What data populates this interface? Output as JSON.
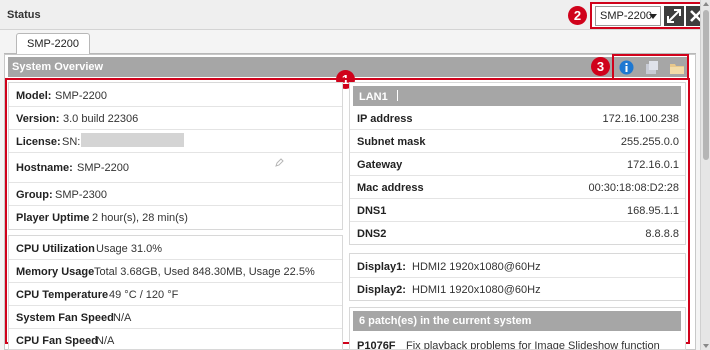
{
  "window": {
    "title": "Status",
    "device_select": "SMP-2200",
    "callouts": {
      "one": "1",
      "two": "2",
      "three": "3"
    }
  },
  "tabs": [
    "SMP-2200"
  ],
  "panel": {
    "title": "System Overview"
  },
  "device": {
    "model_label": "Model:",
    "model_value": "SMP-2200",
    "version_label": "Version:",
    "version_value": "3.0 build 22306",
    "license_label": "License:",
    "license_sn": "SN:",
    "hostname_label": "Hostname:",
    "hostname_value": "SMP-2200",
    "group_label": "Group:",
    "group_value": "SMP-2300",
    "uptime_label": "Player Uptime",
    "uptime_value": "2 hour(s), 28 min(s)"
  },
  "resources": {
    "cpu_label": "CPU Utilization",
    "cpu_value": "Usage 31.0%",
    "mem_label": "Memory Usage",
    "mem_value": "Total 3.68GB, Used 848.30MB, Usage 22.5%",
    "temp_label": "CPU Temperature",
    "temp_value": "49 °C / 120 °F",
    "fan_label": "System Fan Speed",
    "fan_value": "N/A",
    "cpufan_label": "CPU Fan Speed",
    "cpufan_value": "N/A"
  },
  "network": {
    "tab": "LAN1",
    "ip_label": "IP address",
    "ip_value": "172.16.100.238",
    "mask_label": "Subnet mask",
    "mask_value": "255.255.0.0",
    "gw_label": "Gateway",
    "gw_value": "172.16.0.1",
    "mac_label": "Mac address",
    "mac_value": "00:30:18:08:D2:28",
    "dns1_label": "DNS1",
    "dns1_value": "168.95.1.1",
    "dns2_label": "DNS2",
    "dns2_value": "8.8.8.8"
  },
  "displays": {
    "d1_label": "Display1:",
    "d1_value": "HDMI2 1920x1080@60Hz",
    "d2_label": "Display2:",
    "d2_value": "HDMI1 1920x1080@60Hz"
  },
  "patches": {
    "header": "6 patch(es) in the current system",
    "first_id": "P1076F",
    "first_desc": "Fix playback problems for Image Slideshow function"
  },
  "icons": {
    "info": "info-icon",
    "export": "export-icon",
    "folder": "folder-icon",
    "edit": "pencil-icon",
    "expand": "expand-icon",
    "close": "close-icon"
  },
  "colors": {
    "callout": "#d0021b",
    "header_grey": "#a6a6a6",
    "info_blue": "#1e78d2"
  }
}
